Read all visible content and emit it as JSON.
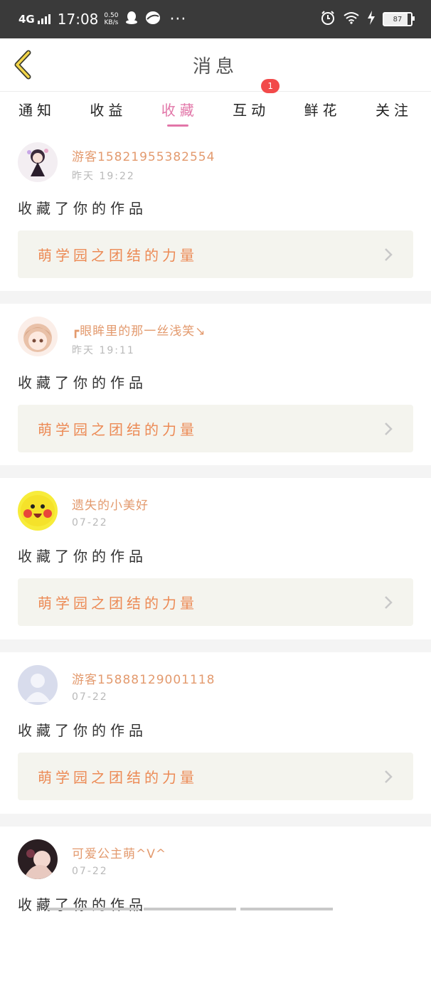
{
  "status_bar": {
    "network": "4G",
    "time": "17:08",
    "speed_value": "0.50",
    "speed_unit": "KB/s",
    "more": "···",
    "battery": "87"
  },
  "header": {
    "title": "消息",
    "back_icon": "chevron-left-icon"
  },
  "tabs": [
    {
      "label": "通知",
      "active": false
    },
    {
      "label": "收益",
      "active": false
    },
    {
      "label": "收藏",
      "active": true
    },
    {
      "label": "互动",
      "active": false,
      "badge": "1"
    },
    {
      "label": "鲜花",
      "active": false
    },
    {
      "label": "关注",
      "active": false
    }
  ],
  "notifications": [
    {
      "name": "游客15821955382554",
      "time": "昨天 19:22",
      "action": "收藏了你的作品",
      "work_title": "萌学园之团结的力量"
    },
    {
      "name": "┏眼眸里的那一丝浅笑↘",
      "time": "昨天 19:11",
      "action": "收藏了你的作品",
      "work_title": "萌学园之团结的力量"
    },
    {
      "name": "遗失的小美好",
      "time": "07-22",
      "action": "收藏了你的作品",
      "work_title": "萌学园之团结的力量"
    },
    {
      "name": "游客15888129001118",
      "time": "07-22",
      "action": "收藏了你的作品",
      "work_title": "萌学园之团结的力量"
    },
    {
      "name": "可爱公主萌^V^",
      "time": "07-22",
      "action": "收藏了你的作品",
      "work_title": ""
    }
  ],
  "colors": {
    "accent": "#e276a8",
    "username": "#e39a6e",
    "work_title": "#ec8a55",
    "badge": "#f24a4a",
    "status_bar_bg": "#3a3a3a",
    "work_box_bg": "#f4f4ee"
  }
}
